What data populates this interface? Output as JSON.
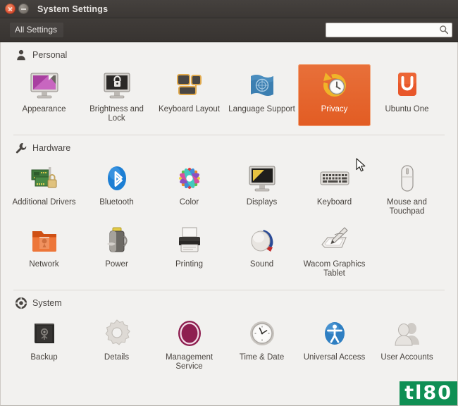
{
  "window": {
    "title": "System Settings",
    "close_icon": "close-icon",
    "minimize_icon": "minimize-icon"
  },
  "toolbar": {
    "all_settings_label": "All Settings",
    "search_value": "",
    "search_placeholder": "",
    "search_icon": "search-icon"
  },
  "colors": {
    "titlebar": "#3c3835",
    "toolbar": "#38342f",
    "content_bg": "#f2f1ef",
    "selection_orange": "#e25c23",
    "label_text": "#49443f",
    "watermark_green": "#0f8f54"
  },
  "sections": [
    {
      "id": "personal",
      "title": "Personal",
      "icon": "person-icon",
      "items": [
        {
          "label": "Appearance",
          "icon": "appearance-icon",
          "selected": false
        },
        {
          "label": "Brightness and Lock",
          "icon": "brightness-lock-icon",
          "selected": false
        },
        {
          "label": "Keyboard Layout",
          "icon": "keyboard-layout-icon",
          "selected": false
        },
        {
          "label": "Language Support",
          "icon": "language-support-icon",
          "selected": false
        },
        {
          "label": "Privacy",
          "icon": "privacy-icon",
          "selected": true
        },
        {
          "label": "Ubuntu One",
          "icon": "ubuntu-one-icon",
          "selected": false
        }
      ]
    },
    {
      "id": "hardware",
      "title": "Hardware",
      "icon": "wrench-icon",
      "items": [
        {
          "label": "Additional Drivers",
          "icon": "additional-drivers-icon",
          "selected": false
        },
        {
          "label": "Bluetooth",
          "icon": "bluetooth-icon",
          "selected": false
        },
        {
          "label": "Color",
          "icon": "color-icon",
          "selected": false
        },
        {
          "label": "Displays",
          "icon": "displays-icon",
          "selected": false
        },
        {
          "label": "Keyboard",
          "icon": "keyboard-icon",
          "selected": false
        },
        {
          "label": "Mouse and Touchpad",
          "icon": "mouse-touchpad-icon",
          "selected": false
        },
        {
          "label": "Network",
          "icon": "network-icon",
          "selected": false
        },
        {
          "label": "Power",
          "icon": "power-icon",
          "selected": false
        },
        {
          "label": "Printing",
          "icon": "printing-icon",
          "selected": false
        },
        {
          "label": "Sound",
          "icon": "sound-icon",
          "selected": false
        },
        {
          "label": "Wacom Graphics Tablet",
          "icon": "wacom-tablet-icon",
          "selected": false
        }
      ]
    },
    {
      "id": "system",
      "title": "System",
      "icon": "system-gear-icon",
      "items": [
        {
          "label": "Backup",
          "icon": "backup-icon",
          "selected": false
        },
        {
          "label": "Details",
          "icon": "details-icon",
          "selected": false
        },
        {
          "label": "Management Service",
          "icon": "management-service-icon",
          "selected": false
        },
        {
          "label": "Time & Date",
          "icon": "time-date-icon",
          "selected": false
        },
        {
          "label": "Universal Access",
          "icon": "universal-access-icon",
          "selected": false
        },
        {
          "label": "User Accounts",
          "icon": "user-accounts-icon",
          "selected": false
        }
      ]
    }
  ],
  "watermark": {
    "text": "tl80"
  },
  "cursor": {
    "icon": "mouse-pointer-icon"
  }
}
